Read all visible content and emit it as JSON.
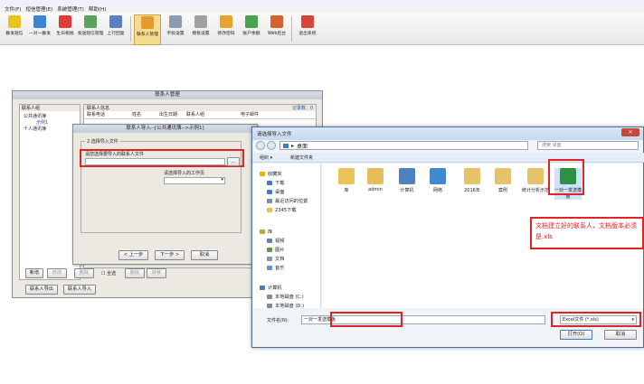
{
  "app": {
    "menu": [
      "文件(F)",
      "短信管理(E)",
      "系统管理(T)",
      "帮助(H)"
    ],
    "toolbar": [
      {
        "label": "群发短信",
        "color": "#e8c21e"
      },
      {
        "label": "一对一群发",
        "color": "#3b85d2"
      },
      {
        "label": "生日祝福",
        "color": "#e03a3a"
      },
      {
        "label": "发送短信管理",
        "color": "#5aa35a"
      },
      {
        "label": "上行回复",
        "color": "#5b7fc2"
      },
      {
        "label": "联系人管理",
        "color": "#e49b2e"
      },
      {
        "label": "字段设置",
        "color": "#8c9bb0"
      },
      {
        "label": "模板设置",
        "color": "#a0a0a0"
      },
      {
        "label": "修改密码",
        "color": "#e8a32b"
      },
      {
        "label": "账户余额",
        "color": "#4aa24f"
      },
      {
        "label": "Web后台",
        "color": "#d4612f"
      },
      {
        "label": "退出系统",
        "color": "#d9433a"
      }
    ]
  },
  "contact_mgr": {
    "title": "联系人管理",
    "group_header": "联系人组",
    "groups": [
      "公共通讯簿",
      "示例1",
      "个人通讯簿"
    ],
    "info_header": "联系人信息",
    "record_count": "记录数：0",
    "columns": [
      "联系电话",
      "姓名",
      "出生日期",
      "联系人组",
      "电子邮件"
    ],
    "buttons": [
      "新增",
      "修改",
      "删除",
      "全选",
      "删除",
      "转移"
    ],
    "bottom_buttons": [
      "联系人导出",
      "联系人导入"
    ]
  },
  "import_wizard": {
    "title": "联系人导入--[公共通讯簿-->示例1]",
    "section": "2.选择导入文件",
    "file_label": "请您选择要导入的联系人文件",
    "file_value": "",
    "browse": "...",
    "sheet_label": "请选择导入的工作页",
    "sheet_value": "",
    "buttons": [
      "< 上一步",
      "下一步 >",
      "取消"
    ]
  },
  "file_dialog": {
    "title": "请选择导入文件",
    "breadcrumb": "桌面",
    "breadcrumb_arrow": "▸",
    "search_placeholder": "搜索 桌面",
    "organize": "组织 ▾",
    "new_folder": "新建文件夹",
    "nav": [
      {
        "label": "收藏夹",
        "color": "#e8b400"
      },
      {
        "label": "下载",
        "color": "#3c7ec8"
      },
      {
        "label": "桌面",
        "color": "#3c7ec8"
      },
      {
        "label": "最近访问的位置",
        "color": "#7b8ea8"
      },
      {
        "label": "2345下载",
        "color": "#e8c050"
      },
      {
        "label": "库",
        "color": "#caa23a"
      },
      {
        "label": "视频",
        "color": "#6a7fa6"
      },
      {
        "label": "图片",
        "color": "#5d9a4c"
      },
      {
        "label": "文档",
        "color": "#8b96a8"
      },
      {
        "label": "音乐",
        "color": "#6b8fd3"
      },
      {
        "label": "计算机",
        "color": "#4d78b0"
      },
      {
        "label": "本地磁盘 (C:)",
        "color": "#8a8a8a"
      },
      {
        "label": "本地磁盘 (D:)",
        "color": "#8a8a8a"
      }
    ],
    "files": [
      {
        "label": "库",
        "color": "#e9c45a"
      },
      {
        "label": "admin",
        "color": "#e5bd5a"
      },
      {
        "label": "计算机",
        "color": "#4d82c0"
      },
      {
        "label": "网络",
        "color": "#3f8ad0"
      },
      {
        "label": "2016年",
        "color": "#e6c36a"
      },
      {
        "label": "案例",
        "color": "#e6c36a"
      },
      {
        "label": "统计分析示范",
        "color": "#e6c36a"
      },
      {
        "label": "一对一发送模板",
        "color": "#2f9146"
      }
    ],
    "annotation": "文档建立好的联系人，文档版本必须是.xls",
    "filename_label": "文件名(N):",
    "filename_value": "一对一发送模板",
    "filetype": "Excel文件 (*.xls)",
    "open": "打开(O)",
    "cancel": "取消"
  }
}
